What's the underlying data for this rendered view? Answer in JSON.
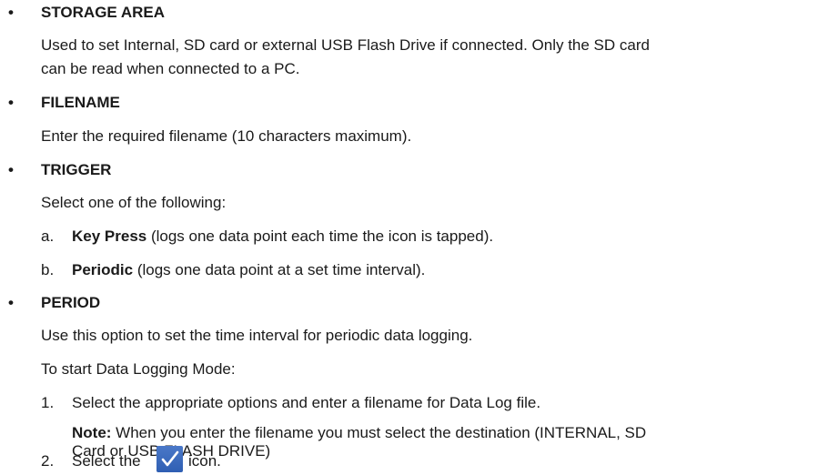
{
  "sections": [
    {
      "bullet": "•",
      "heading": "STORAGE AREA",
      "lines": [
        "Used to set Internal, SD card or external USB Flash Drive if connected. Only the SD card",
        "can be read when connected to a PC."
      ]
    },
    {
      "bullet": "•",
      "heading": "FILENAME",
      "lines": [
        "Enter the required filename (10 characters maximum)."
      ]
    },
    {
      "bullet": "•",
      "heading": "TRIGGER",
      "lines": [
        "Select one of the following:"
      ],
      "options": [
        {
          "marker": "a.",
          "bold": "Key Press",
          "rest": " (logs one data point each time the icon is tapped)."
        },
        {
          "marker": "b.",
          "bold": "Periodic",
          "rest": " (logs one data point at a set time interval)."
        }
      ]
    },
    {
      "bullet": "•",
      "heading": "PERIOD",
      "lines": [
        "Use this option to set the time interval for periodic data logging.",
        "To start Data Logging Mode:"
      ]
    }
  ],
  "steps": [
    {
      "number": "1.",
      "text": "Select the appropriate options and enter a filename for Data Log file.",
      "note_label": "Note:",
      "note_text": " When you enter the filename you must select the destination (INTERNAL, SD",
      "note_text_2": "Card or USB FLASH DRIVE)"
    },
    {
      "number": "2.",
      "text_before": "Select the",
      "icon": "checkmark-icon",
      "text_after": "icon."
    }
  ],
  "colors": {
    "text": "#1a1a1a",
    "icon_background": "#3a68bd",
    "icon_check": "#ffffff"
  }
}
